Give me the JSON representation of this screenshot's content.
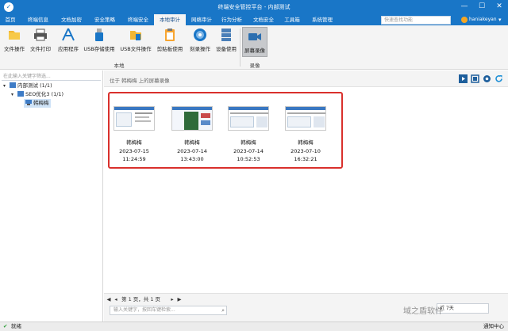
{
  "window": {
    "title": "终端安全管控平台 - 内部测试",
    "minimize": "—",
    "maximize": "☐",
    "close": "✕"
  },
  "menu": {
    "items": [
      {
        "label": "首页"
      },
      {
        "label": "终端信息"
      },
      {
        "label": "文档加密"
      },
      {
        "label": "安全策略"
      },
      {
        "label": "终端安全"
      },
      {
        "label": "本地审计"
      },
      {
        "label": "网络审计"
      },
      {
        "label": "行为分析"
      },
      {
        "label": "文档安全"
      },
      {
        "label": "工具箱"
      },
      {
        "label": "系统管理"
      }
    ],
    "active": "本地审计",
    "search_placeholder": "快速查找功能",
    "user": "haniakeyan",
    "more": "▾"
  },
  "ribbon": {
    "buttons": [
      {
        "label": "文件操作",
        "icon": "file-operation-icon"
      },
      {
        "label": "文件打印",
        "icon": "printer-icon"
      },
      {
        "label": "应用程序",
        "icon": "application-icon"
      },
      {
        "label": "USB存储使用",
        "icon": "usb-drive-icon"
      },
      {
        "label": "USB文件操作",
        "icon": "usb-file-icon"
      },
      {
        "label": "剪贴板使用",
        "icon": "clipboard-icon"
      },
      {
        "label": "刻录操作",
        "icon": "disc-burn-icon"
      },
      {
        "label": "设备使用",
        "icon": "device-icon"
      },
      {
        "label": "屏幕录像",
        "icon": "screen-record-icon"
      }
    ],
    "group_local": "本地",
    "group_record": "录像"
  },
  "tree": {
    "search_placeholder": "在此输入关键字筛选...",
    "nodes": [
      {
        "label": "内部测试 (1/1)"
      },
      {
        "label": "SEO优化3 (1/1)"
      },
      {
        "label": "韩梅梅"
      }
    ]
  },
  "main": {
    "caption": "位于 韩梅梅 上的屏幕录像",
    "recordings": [
      {
        "name": "韩梅梅",
        "date": "2023-07-15",
        "time": "11:24:59"
      },
      {
        "name": "韩梅梅",
        "date": "2023-07-14",
        "time": "13:43:00"
      },
      {
        "name": "韩梅梅",
        "date": "2023-07-14",
        "time": "10:52:53"
      },
      {
        "name": "韩梅梅",
        "date": "2023-07-10",
        "time": "16:32:21"
      }
    ],
    "pager": {
      "first": "◀",
      "prev": "◂",
      "text": "第 1 页，共 1 页",
      "next": "▸",
      "last": "▶"
    },
    "bottom_search_placeholder": "输入关键字，按回车键检索...",
    "select_value": "近 7天"
  },
  "status": {
    "text": "就绪",
    "notify": "通知中心"
  },
  "watermark": "域之盾软件",
  "colors": {
    "brand": "#1976c7",
    "highlight": "#d9302c"
  }
}
